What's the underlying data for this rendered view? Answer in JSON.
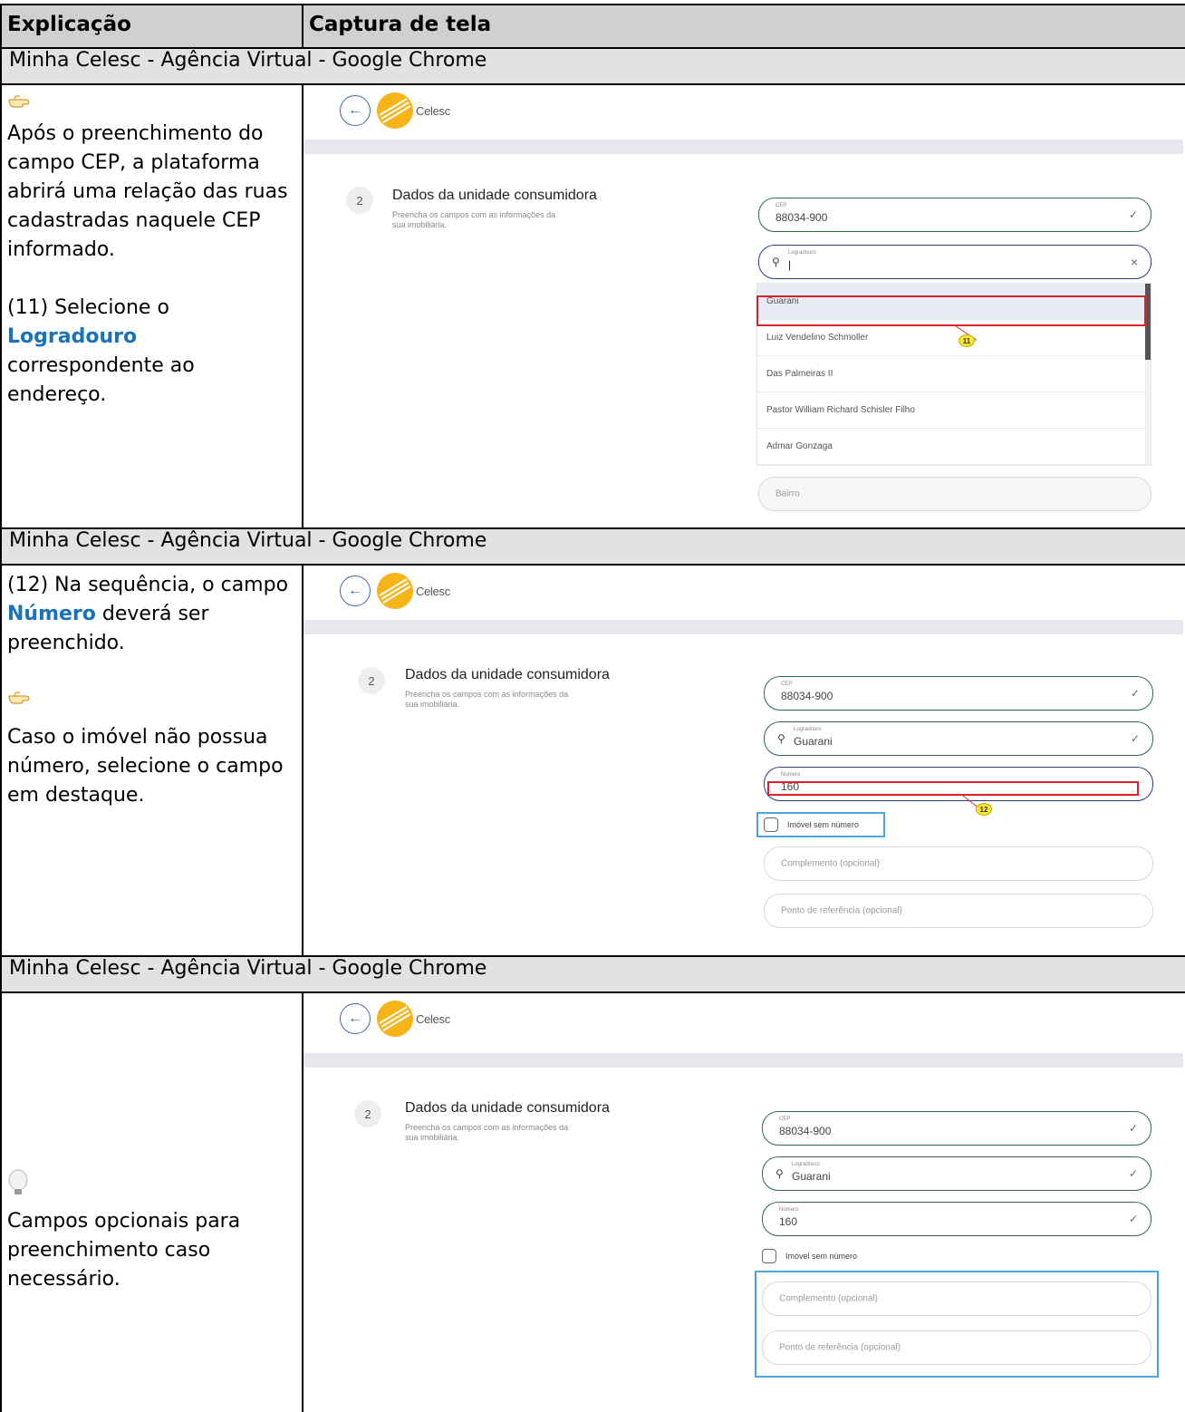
{
  "header": {
    "col1": "Explicação",
    "col2": "Captura de tela"
  },
  "window_title": "Minha Celesc - Agência Virtual - Google Chrome",
  "app": {
    "brand": "Celesc",
    "back_icon": "back-arrow-icon"
  },
  "form": {
    "step_number": "2",
    "title": "Dados da unidade consumidora",
    "desc_line1": "Preencha os campos com as informações da",
    "desc_line2": "sua imobiliária.",
    "cep_label": "CEP",
    "cep_value": "88034-900",
    "logradouro_label": "Logradouro",
    "logradouro_value": "Guarani",
    "numero_label": "Número",
    "numero_value_typing": "160",
    "numero_value": "160",
    "bairro_placeholder": "Bairro",
    "sem_numero_label": "Imóvel sem número",
    "complemento_placeholder": "Complemento (opcional)",
    "referencia_placeholder": "Ponto de referência (opcional)"
  },
  "logradouro_options": [
    "Guarani",
    "Luiz Vendelino Schmoller",
    "Das Palmeiras II",
    "Pastor William Richard Schisler Filho",
    "Admar Gonzaga"
  ],
  "callouts": {
    "c11": "11",
    "c12": "12"
  },
  "row1": {
    "p1": "Após o preenchimento do campo CEP, a plataforma abrirá uma relação das ruas cadastradas naquele CEP informado.",
    "p2_pre": "(11) Selecione o ",
    "p2_hl": "Logradouro",
    "p2_post": " correspondente ao endereço."
  },
  "row2": {
    "p1_pre": "(12) Na sequência, o campo ",
    "p1_hl": "Número",
    "p1_post": " deverá ser preenchido.",
    "p2": " Caso o imóvel não possua número, selecione o campo em destaque."
  },
  "row3": {
    "p1": "Campos opcionais para preenchimento caso necessário."
  },
  "colors": {
    "highlight": "#1a73b8",
    "red_frame": "#e0202a",
    "blue_frame": "#4aa6e0"
  }
}
